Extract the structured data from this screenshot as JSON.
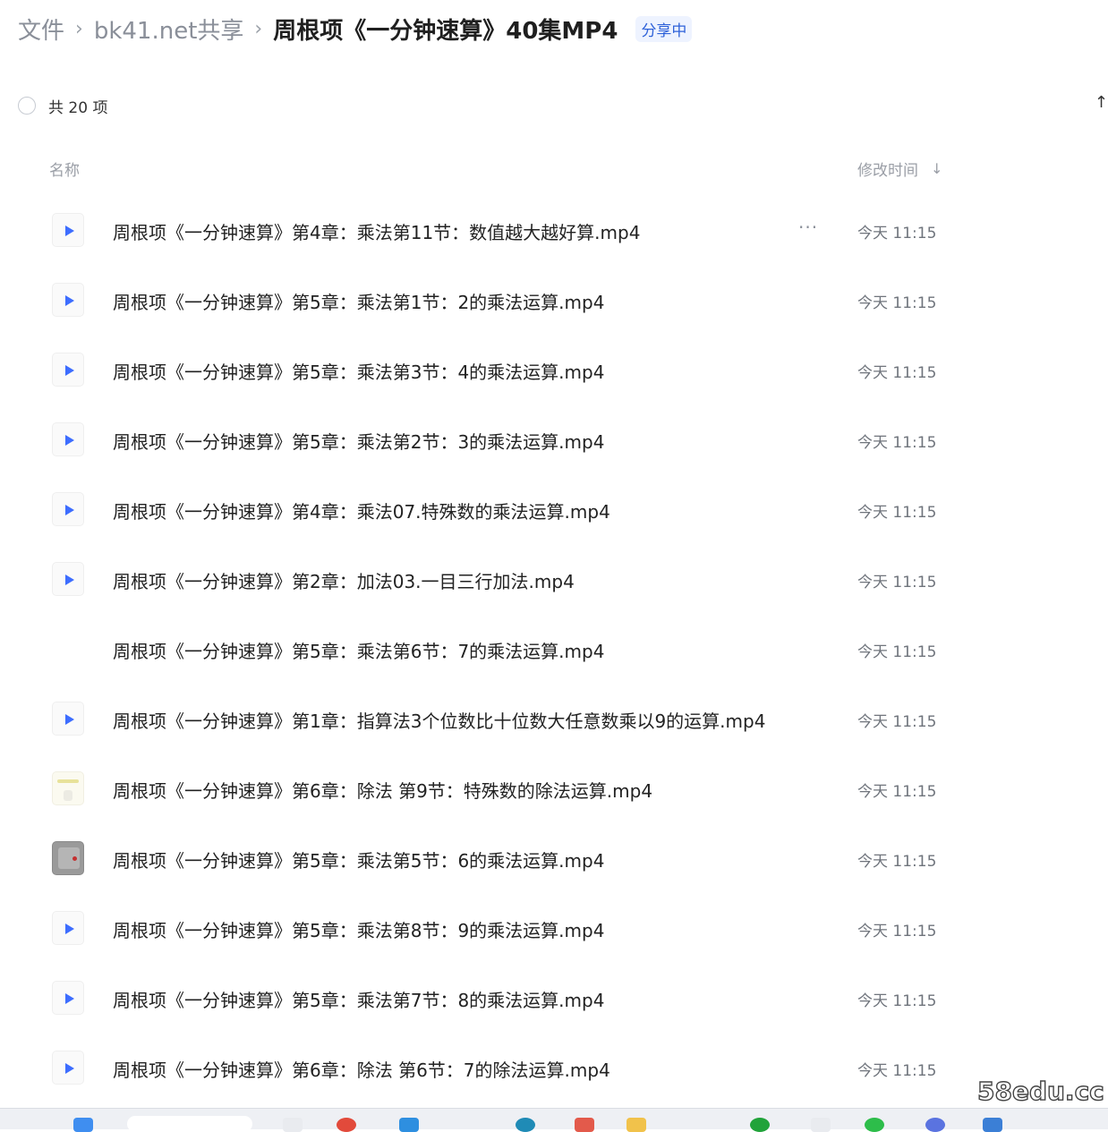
{
  "breadcrumb": {
    "root": "文件",
    "folder": "bk41.net共享",
    "current": "周根项《一分钟速算》40集MP4",
    "share_status": "分享中",
    "separator": "›"
  },
  "toolbar": {
    "count_label": "共 20 项",
    "sort_icon": "↑"
  },
  "columns": {
    "name": "名称",
    "time": "修改时间",
    "time_sort": "↓"
  },
  "more_glyph": "···",
  "files": [
    {
      "name": "周根项《一分钟速算》第4章：乘法第11节：数值越大越好算.mp4",
      "time": "今天 11:15",
      "icon": "video"
    },
    {
      "name": "周根项《一分钟速算》第5章：乘法第1节：2的乘法运算.mp4",
      "time": "今天 11:15",
      "icon": "video"
    },
    {
      "name": "周根项《一分钟速算》第5章：乘法第3节：4的乘法运算.mp4",
      "time": "今天 11:15",
      "icon": "video"
    },
    {
      "name": "周根项《一分钟速算》第5章：乘法第2节：3的乘法运算.mp4",
      "time": "今天 11:15",
      "icon": "video"
    },
    {
      "name": "周根项《一分钟速算》第4章：乘法07.特殊数的乘法运算.mp4",
      "time": "今天 11:15",
      "icon": "video"
    },
    {
      "name": "周根项《一分钟速算》第2章：加法03.一目三行加法.mp4",
      "time": "今天 11:15",
      "icon": "video"
    },
    {
      "name": "周根项《一分钟速算》第5章：乘法第6节：7的乘法运算.mp4",
      "time": "今天 11:15",
      "icon": "blank"
    },
    {
      "name": "周根项《一分钟速算》第1章：指算法3个位数比十位数大任意数乘以9的运算.mp4",
      "time": "今天 11:15",
      "icon": "video"
    },
    {
      "name": "周根项《一分钟速算》第6章：除法 第9节：特殊数的除法运算.mp4",
      "time": "今天 11:15",
      "icon": "thumb-light"
    },
    {
      "name": "周根项《一分钟速算》第5章：乘法第5节：6的乘法运算.mp4",
      "time": "今天 11:15",
      "icon": "thumb-gray"
    },
    {
      "name": "周根项《一分钟速算》第5章：乘法第8节：9的乘法运算.mp4",
      "time": "今天 11:15",
      "icon": "video"
    },
    {
      "name": "周根项《一分钟速算》第5章：乘法第7节：8的乘法运算.mp4",
      "time": "今天 11:15",
      "icon": "video"
    },
    {
      "name": "周根项《一分钟速算》第6章：除法 第6节：7的除法运算.mp4",
      "time": "今天 11:15",
      "icon": "video"
    }
  ],
  "watermark": "58edu.cc",
  "colors": {
    "accent": "#3d6dff",
    "share_badge": "#2f62d9",
    "muted_text": "#9a9ea6"
  }
}
